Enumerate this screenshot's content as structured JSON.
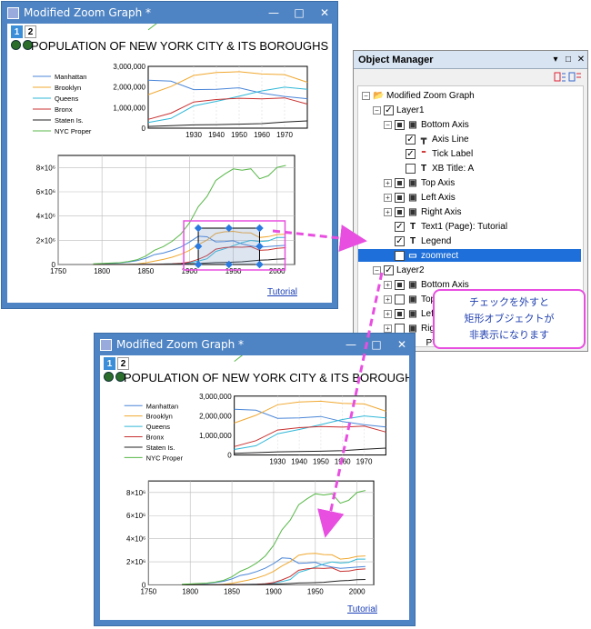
{
  "windows": {
    "top": {
      "title": "Modified Zoom Graph *"
    },
    "bottom": {
      "title": "Modified Zoom Graph *"
    }
  },
  "window_controls": {
    "minimize": "—",
    "maximize": "□",
    "close": "✕"
  },
  "graph": {
    "layer_tabs": [
      "1",
      "2"
    ],
    "title": "POPULATION OF NEW YORK CITY & ITS BOROUGHS",
    "legend": [
      "Manhattan",
      "Brooklyn",
      "Queens",
      "Bronx",
      "Staten Is.",
      "NYC Proper"
    ],
    "tutorial_label": "Tutorial"
  },
  "chart_data": [
    {
      "type": "line",
      "title": "",
      "x": [
        1910,
        1920,
        1930,
        1940,
        1950,
        1960,
        1970,
        1980
      ],
      "xlim": [
        1910,
        1980
      ],
      "ylim": [
        0,
        3000000
      ],
      "x_ticks": [
        "1930",
        "1940",
        "1950",
        "1960",
        "1970"
      ],
      "y_ticks": [
        "0",
        "1,000,000",
        "2,000,000",
        "3,000,000"
      ],
      "series": [
        {
          "name": "Manhattan",
          "color": "#4a86d8",
          "values": [
            2330000,
            2280000,
            1870000,
            1890000,
            1960000,
            1700000,
            1540000,
            1430000
          ]
        },
        {
          "name": "Brooklyn",
          "color": "#f0a830",
          "values": [
            1630000,
            2020000,
            2560000,
            2700000,
            2740000,
            2630000,
            2600000,
            2230000
          ]
        },
        {
          "name": "Queens",
          "color": "#30b8d8",
          "values": [
            280000,
            470000,
            1080000,
            1300000,
            1550000,
            1810000,
            1990000,
            1890000
          ]
        },
        {
          "name": "Bronx",
          "color": "#c83030",
          "values": [
            430000,
            730000,
            1270000,
            1390000,
            1450000,
            1420000,
            1470000,
            1170000
          ]
        },
        {
          "name": "Staten Is.",
          "color": "#202020",
          "values": [
            86000,
            117000,
            158000,
            174000,
            192000,
            222000,
            295000,
            352000
          ]
        },
        {
          "name": "NYC Proper",
          "color": "#58b848",
          "values": [
            4770000,
            5620000,
            6930000,
            7450000,
            7890000,
            7780000,
            7890000,
            7070000
          ]
        }
      ]
    },
    {
      "type": "line",
      "title": "",
      "x": [
        1790,
        1800,
        1810,
        1820,
        1830,
        1840,
        1850,
        1860,
        1870,
        1880,
        1890,
        1900,
        1910,
        1920,
        1930,
        1940,
        1950,
        1960,
        1970,
        1980,
        1990,
        2000,
        2010
      ],
      "xlim": [
        1750,
        2020
      ],
      "ylim": [
        0,
        9000000
      ],
      "x_ticks": [
        "1750",
        "1800",
        "1850",
        "1900",
        "1950",
        "2000"
      ],
      "y_ticks": [
        "0",
        "2×10⁶",
        "4×10⁶",
        "6×10⁶",
        "8×10⁶"
      ],
      "series": [
        {
          "name": "Manhattan",
          "color": "#4a86d8",
          "values": [
            33000,
            60000,
            96000,
            124000,
            203000,
            313000,
            516000,
            814000,
            942000,
            1164000,
            1441000,
            1850000,
            2331000,
            2284000,
            1867000,
            1890000,
            1960000,
            1698000,
            1539000,
            1428000,
            1488000,
            1537000,
            1586000
          ]
        },
        {
          "name": "Brooklyn",
          "color": "#f0a830",
          "values": [
            5000,
            6000,
            8000,
            11000,
            21000,
            48000,
            139000,
            279000,
            420000,
            599000,
            839000,
            1167000,
            1634000,
            2018000,
            2560000,
            2698000,
            2738000,
            2627000,
            2602000,
            2231000,
            2301000,
            2465000,
            2505000
          ]
        },
        {
          "name": "Queens",
          "color": "#30b8d8",
          "values": [
            6000,
            7000,
            7000,
            8000,
            9000,
            14000,
            19000,
            32000,
            45000,
            57000,
            87000,
            153000,
            284000,
            469000,
            1079000,
            1298000,
            1551000,
            1810000,
            1986000,
            1891000,
            1952000,
            2229000,
            2231000
          ]
        },
        {
          "name": "Bronx",
          "color": "#c83030",
          "values": [
            1800,
            1800,
            2300,
            2800,
            3000,
            5300,
            8000,
            23000,
            37000,
            52000,
            89000,
            201000,
            431000,
            732000,
            1265000,
            1395000,
            1451000,
            1425000,
            1472000,
            1169000,
            1204000,
            1333000,
            1385000
          ]
        },
        {
          "name": "Staten Is.",
          "color": "#202020",
          "values": [
            3800,
            4600,
            5300,
            6100,
            7100,
            10900,
            15000,
            25000,
            33000,
            39000,
            52000,
            67000,
            86000,
            117000,
            158000,
            174000,
            192000,
            222000,
            295000,
            352000,
            379000,
            444000,
            468000
          ]
        },
        {
          "name": "NYC Proper",
          "color": "#58b848",
          "values": [
            49000,
            79000,
            119000,
            152000,
            242000,
            391000,
            696000,
            1174000,
            1478000,
            1912000,
            2507000,
            3437000,
            4767000,
            5620000,
            6930000,
            7455000,
            7892000,
            7782000,
            7895000,
            7072000,
            7323000,
            8008000,
            8175000
          ]
        }
      ]
    }
  ],
  "object_manager": {
    "title": "Object Manager",
    "title_controls": [
      "▾",
      "□",
      "✕"
    ],
    "items": [
      {
        "label": "Modified Zoom Graph",
        "depth": 0,
        "expander": "−",
        "check": "none",
        "icon": "folder"
      },
      {
        "label": "Layer1",
        "depth": 1,
        "expander": "−",
        "check": "checked",
        "icon": "none"
      },
      {
        "label": "Bottom Axis",
        "depth": 2,
        "expander": "−",
        "check": "partial",
        "icon": "axis"
      },
      {
        "label": "Axis Line",
        "depth": 3,
        "expander": "",
        "check": "checked",
        "icon": "axis-line"
      },
      {
        "label": "Tick Label",
        "depth": 3,
        "expander": "",
        "check": "checked",
        "icon": "tick-label"
      },
      {
        "label": "XB Title: A",
        "depth": 3,
        "expander": "",
        "check": "unchecked",
        "icon": "text"
      },
      {
        "label": "Top Axis",
        "depth": 2,
        "expander": "+",
        "check": "partial",
        "icon": "axis"
      },
      {
        "label": "Left Axis",
        "depth": 2,
        "expander": "+",
        "check": "partial",
        "icon": "axis"
      },
      {
        "label": "Right Axis",
        "depth": 2,
        "expander": "+",
        "check": "partial",
        "icon": "axis"
      },
      {
        "label": "Text1 (Page): Tutorial",
        "depth": 2,
        "expander": "",
        "check": "checked",
        "icon": "text"
      },
      {
        "label": "Legend",
        "depth": 2,
        "expander": "",
        "check": "checked",
        "icon": "text"
      },
      {
        "label": "zoomrect",
        "depth": 2,
        "expander": "",
        "check": "unchecked",
        "icon": "rect",
        "selected": true
      },
      {
        "label": "Layer2",
        "depth": 1,
        "expander": "−",
        "check": "checked",
        "icon": "none"
      },
      {
        "label": "Bottom Axis",
        "depth": 2,
        "expander": "+",
        "check": "partial",
        "icon": "axis"
      },
      {
        "label": "Top Axis",
        "depth": 2,
        "expander": "+",
        "check": "unchecked",
        "icon": "axis"
      },
      {
        "label": "Left Axis",
        "depth": 2,
        "expander": "+",
        "check": "partial",
        "icon": "axis"
      },
      {
        "label": "Right Axis",
        "depth": 2,
        "expander": "+",
        "check": "unchecked",
        "icon": "axis"
      },
      {
        "label": "_PTI",
        "depth": 2,
        "expander": "",
        "check": "checked",
        "icon": "text"
      }
    ]
  },
  "callout": {
    "lines": [
      "チェックを外すと",
      "矩形オブジェクトが",
      "非表示になります"
    ],
    "border_color": "#e84ee0"
  }
}
